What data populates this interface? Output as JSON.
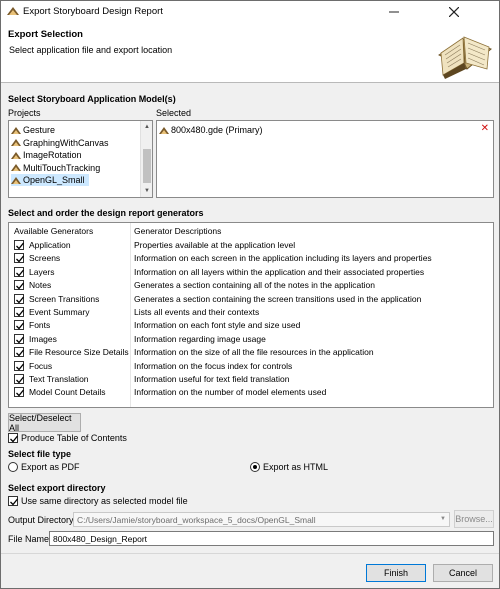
{
  "window": {
    "title": "Export Storyboard Design Report"
  },
  "banner": {
    "title": "Export Selection",
    "subtitle": "Select application file and export location"
  },
  "model_section": {
    "title": "Select Storyboard Application Model(s)",
    "projects_label": "Projects",
    "selected_label": "Selected",
    "projects": [
      "Gesture",
      "GraphingWithCanvas",
      "ImageRotation",
      "MultiTouchTracking",
      "OpenGL_Small"
    ],
    "selected_project": "OpenGL_Small",
    "selected_items": [
      "800x480.gde (Primary)"
    ],
    "remove_glyph": "✕"
  },
  "generators_section": {
    "title": "Select and order the design report generators",
    "col_available": "Available Generators",
    "col_descriptions": "Generator Descriptions",
    "rows": [
      {
        "name": "Application",
        "desc": "Properties available at the application level",
        "checked": true
      },
      {
        "name": "Screens",
        "desc": "Information on each screen in the application including its layers and properties",
        "checked": true
      },
      {
        "name": "Layers",
        "desc": "Information on all layers within the application and their associated properties",
        "checked": true
      },
      {
        "name": "Notes",
        "desc": "Generates a section containing all of the notes in the application",
        "checked": true
      },
      {
        "name": "Screen Transitions",
        "desc": "Generates a section containing the screen transitions used in the application",
        "checked": true
      },
      {
        "name": "Event Summary",
        "desc": "Lists all events and their contexts",
        "checked": true
      },
      {
        "name": "Fonts",
        "desc": "Information on each font style and size used",
        "checked": true
      },
      {
        "name": "Images",
        "desc": "Information regarding image usage",
        "checked": true
      },
      {
        "name": "File Resource Size Details",
        "desc": "Information on the size of all the file resources in the application",
        "checked": true
      },
      {
        "name": "Focus",
        "desc": "Information on the focus index for controls",
        "checked": true
      },
      {
        "name": "Text Translation",
        "desc": "Information useful for text field translation",
        "checked": true
      },
      {
        "name": "Model Count Details",
        "desc": "Information on the number of model elements used",
        "checked": true
      }
    ],
    "select_all_label": "Select/Deselect All",
    "toc_label": "Produce Table of Contents",
    "toc_checked": true
  },
  "file_type_section": {
    "title": "Select file type",
    "pdf_label": "Export as PDF",
    "html_label": "Export as HTML",
    "selected": "html"
  },
  "export_dir_section": {
    "title": "Select export directory",
    "same_dir_label": "Use same directory as selected model file",
    "same_dir_checked": true,
    "output_dir_label": "Output Directory:",
    "output_dir_value": "C:/Users/Jamie/storyboard_workspace_5_docs/OpenGL_Small",
    "browse_label": "Browse...",
    "file_name_label": "File Name:",
    "file_name_value": "800x480_Design_Report"
  },
  "footer": {
    "finish_label": "Finish",
    "cancel_label": "Cancel"
  }
}
